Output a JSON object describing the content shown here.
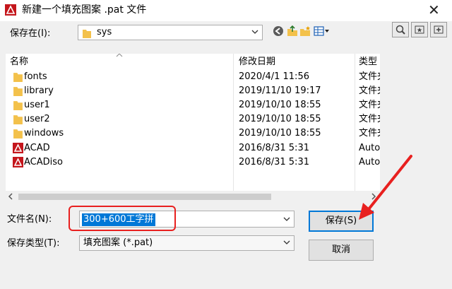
{
  "window": {
    "title": "新建一个填充图案 .pat 文件",
    "close_glyph": "✕"
  },
  "save_in": {
    "label": "保存在(I):",
    "value": "sys"
  },
  "columns": {
    "name": "名称",
    "date": "修改日期",
    "type": "类型"
  },
  "files": [
    {
      "name": "fonts",
      "date": "2020/4/1 11:56",
      "type": "文件夹",
      "icon": "folder-icon"
    },
    {
      "name": "library",
      "date": "2019/11/10 19:17",
      "type": "文件夹",
      "icon": "folder-icon"
    },
    {
      "name": "user1",
      "date": "2019/10/10 18:55",
      "type": "文件夹",
      "icon": "folder-icon"
    },
    {
      "name": "user2",
      "date": "2019/10/10 18:55",
      "type": "文件夹",
      "icon": "folder-icon"
    },
    {
      "name": "windows",
      "date": "2019/10/10 18:55",
      "type": "文件夹",
      "icon": "folder-icon"
    },
    {
      "name": "ACAD",
      "date": "2016/8/31 5:31",
      "type": "Auto",
      "icon": "autocad-file-icon"
    },
    {
      "name": "ACADiso",
      "date": "2016/8/31 5:31",
      "type": "Auto",
      "icon": "autocad-file-icon"
    }
  ],
  "filename": {
    "label": "文件名(N):",
    "value": "300+600工字拼"
  },
  "filetype": {
    "label": "保存类型(T):",
    "value": "填充图案 (*.pat)"
  },
  "buttons": {
    "save": "保存(S)",
    "cancel": "取消"
  },
  "colors": {
    "selection": "#0078d7",
    "annotation_red": "#e8201f",
    "folder": "#f3c14b"
  }
}
